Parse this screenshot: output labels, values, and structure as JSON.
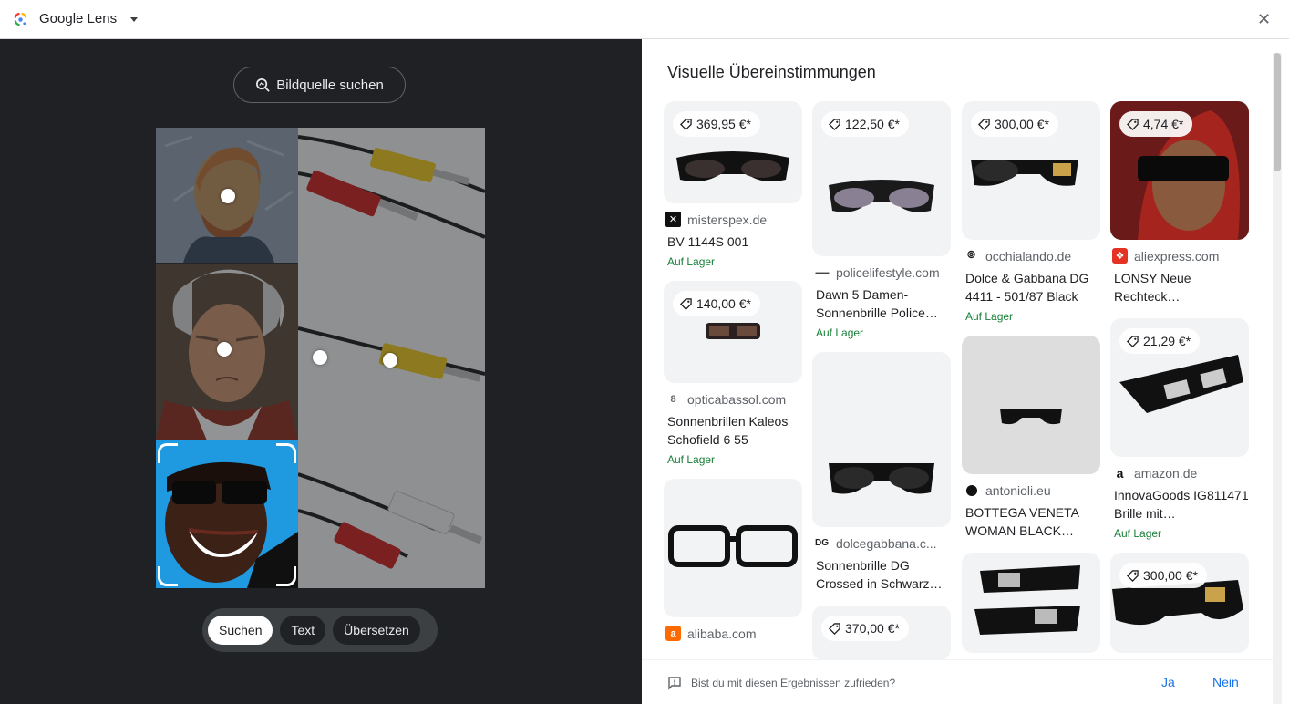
{
  "titlebar": {
    "title": "Google Lens",
    "close_icon": "close-icon"
  },
  "left": {
    "source_button": "Bildquelle suchen",
    "modes": [
      {
        "label": "Suchen",
        "active": true
      },
      {
        "label": "Text",
        "active": false
      },
      {
        "label": "Übersetzen",
        "active": false
      }
    ]
  },
  "results": {
    "heading": "Visuelle Übereinstimmungen",
    "columns": [
      [
        {
          "price": "369,95 €*",
          "site": "misterspex.de",
          "title": "BV 1144S 001",
          "stock": "Auf Lager",
          "thumb_h": 112,
          "img": "glasses-dark-wrap"
        },
        {
          "price": "140,00 €*",
          "site": "opticabassol.com",
          "title": "Sonnenbrillen Kaleos Schofield 6 55",
          "stock": "Auf Lager",
          "thumb_h": 112,
          "img": "glasses-small-brown"
        },
        {
          "price": "",
          "site": "alibaba.com",
          "title": "",
          "stock": "",
          "thumb_h": 152,
          "img": "glasses-clear-frame"
        }
      ],
      [
        {
          "price": "122,50 €*",
          "site": "policelifestyle.com",
          "title": "Dawn 5 Damen-Sonnenbrille Police…",
          "stock": "Auf Lager",
          "thumb_h": 170,
          "img": "glasses-gray-lens"
        },
        {
          "price": "",
          "site": "dolcegabbana.c...",
          "title": "Sonnenbrille DG Crossed in Schwarz…",
          "stock": "",
          "thumb_h": 192,
          "img": "glasses-dg-black"
        },
        {
          "price": "370,00 €*",
          "site": "",
          "title": "",
          "stock": "",
          "thumb_h": 60,
          "img": "none"
        }
      ],
      [
        {
          "price": "300,00 €*",
          "site": "occhialando.de",
          "title": "Dolce & Gabbana DG 4411 - 501/87 Black",
          "stock": "Auf Lager",
          "thumb_h": 152,
          "img": "glasses-dg-gold"
        },
        {
          "price": "",
          "site": "antonioli.eu",
          "title": "BOTTEGA VENETA WOMAN BLACK…",
          "stock": "",
          "thumb_h": 152,
          "img": "glasses-bottega-small"
        },
        {
          "price": "",
          "site": "",
          "title": "",
          "stock": "",
          "thumb_h": 110,
          "img": "glasses-prism-pair"
        }
      ],
      [
        {
          "price": "4,74 €*",
          "site": "aliexpress.com",
          "title": "LONSY Neue Rechteck…",
          "stock": "",
          "thumb_h": 152,
          "img": "person-red-scarf"
        },
        {
          "price": "21,29 €*",
          "site": "amazon.de",
          "title": "InnovaGoods IG811471 Brille mit…",
          "stock": "Auf Lager",
          "thumb_h": 152,
          "img": "glasses-prism-single"
        },
        {
          "price": "300,00 €*",
          "site": "",
          "title": "",
          "stock": "",
          "thumb_h": 110,
          "img": "glasses-dg-black-side"
        }
      ]
    ]
  },
  "feedback": {
    "question": "Bist du mit diesen Ergebnissen zufrieden?",
    "yes": "Ja",
    "no": "Nein"
  }
}
